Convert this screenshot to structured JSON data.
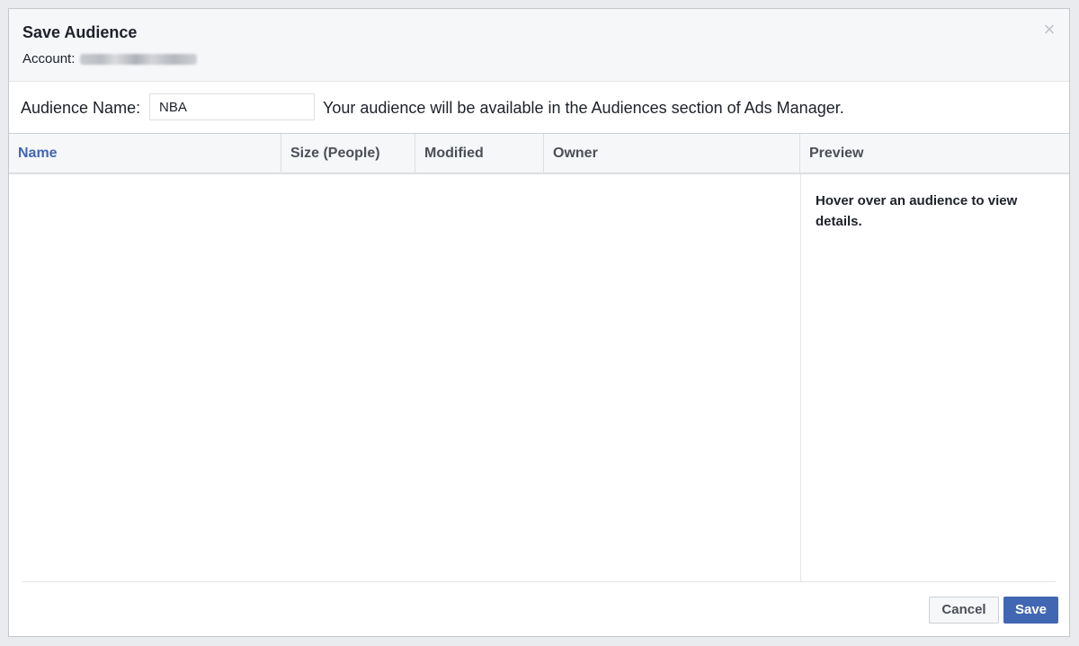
{
  "dialog": {
    "title": "Save Audience",
    "account_label": "Account:",
    "close_glyph": "×"
  },
  "name_row": {
    "label": "Audience Name:",
    "input_value": "NBA",
    "help_text": "Your audience will be available in the Audiences section of Ads Manager."
  },
  "table": {
    "columns": [
      {
        "label": "Name"
      },
      {
        "label": "Size (People)"
      },
      {
        "label": "Modified"
      },
      {
        "label": "Owner"
      }
    ]
  },
  "preview": {
    "header": "Preview",
    "placeholder": "Hover over an audience to view details."
  },
  "footer": {
    "cancel_label": "Cancel",
    "save_label": "Save"
  },
  "colors": {
    "accent": "#4267b2",
    "header_bg": "#f6f7f9",
    "text": "#1d2129"
  },
  "icons": {
    "close": "close-icon"
  }
}
